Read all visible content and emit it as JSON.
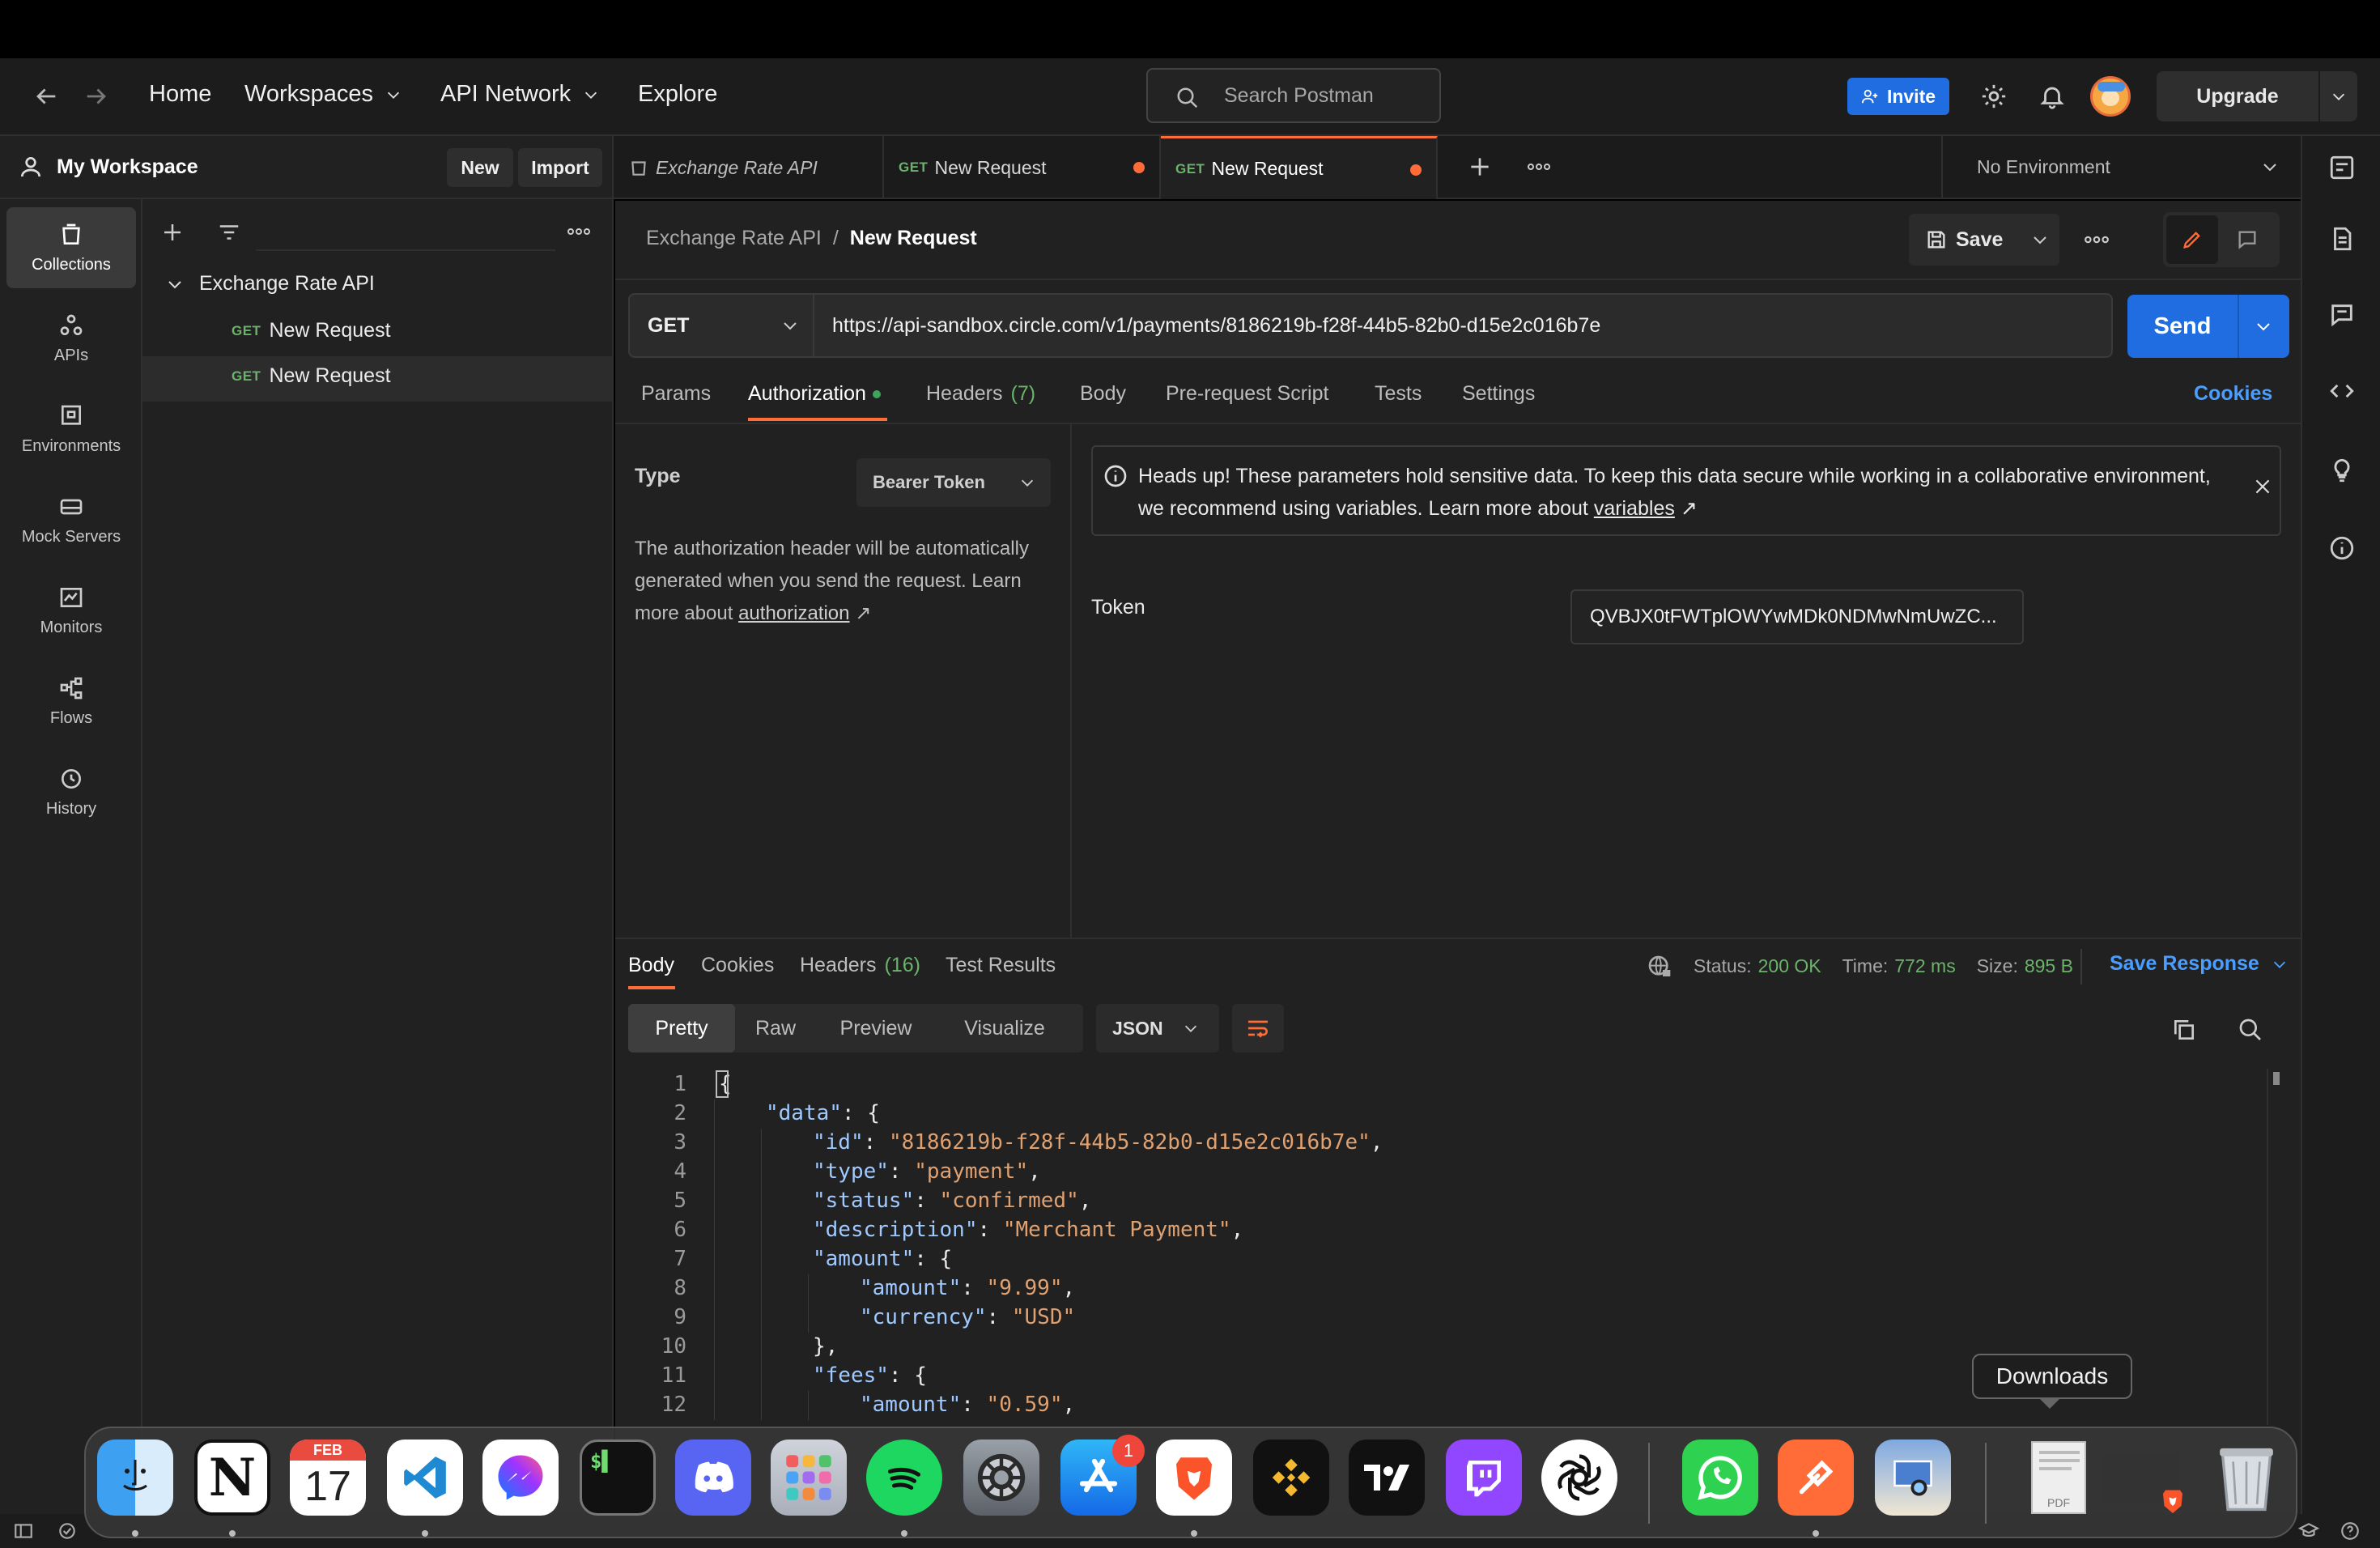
{
  "topbar": {
    "nav": [
      "Home",
      "Workspaces",
      "API Network",
      "Explore"
    ],
    "search_placeholder": "Search Postman",
    "invite_label": "Invite",
    "upgrade_label": "Upgrade"
  },
  "workspace": {
    "name": "My Workspace",
    "new_label": "New",
    "import_label": "Import"
  },
  "rail": [
    "Collections",
    "APIs",
    "Environments",
    "Mock Servers",
    "Monitors",
    "Flows",
    "History"
  ],
  "sidebar": {
    "collection": "Exchange Rate API",
    "requests": [
      {
        "method": "GET",
        "name": "New Request"
      },
      {
        "method": "GET",
        "name": "New Request"
      }
    ]
  },
  "tabs": [
    {
      "method": "",
      "label": "Exchange Rate API"
    },
    {
      "method": "GET",
      "label": "New Request"
    },
    {
      "method": "GET",
      "label": "New Request"
    }
  ],
  "environment": "No Environment",
  "breadcrumb": {
    "parent": "Exchange Rate API",
    "sep": "/",
    "current": "New Request"
  },
  "save_label": "Save",
  "request": {
    "method": "GET",
    "url": "https://api-sandbox.circle.com/v1/payments/8186219b-f28f-44b5-82b0-d15e2c016b7e",
    "send_label": "Send",
    "tabs": [
      "Params",
      "Authorization",
      "Headers",
      "Body",
      "Pre-request Script",
      "Tests",
      "Settings"
    ],
    "headers_count": "(7)",
    "cookies_label": "Cookies"
  },
  "auth": {
    "type_label": "Type",
    "type_value": "Bearer Token",
    "description": "The authorization header will be automatically generated when you send the request. Learn more about",
    "description_link": "authorization",
    "notice_line1": "Heads up! These parameters hold sensitive data. To keep this data secure while working in a collaborative environment,",
    "notice_line2": "we recommend using variables. Learn more about",
    "notice_link": "variables",
    "token_label": "Token",
    "token_value": "QVBJX0tFWTplOWYwMDk0NDMwNmUwZC..."
  },
  "response": {
    "tabs": [
      "Body",
      "Cookies",
      "Headers",
      "Test Results"
    ],
    "headers_count": "(16)",
    "status_label": "Status:",
    "status_value": "200 OK",
    "time_label": "Time:",
    "time_value": "772 ms",
    "size_label": "Size:",
    "size_value": "895 B",
    "save_response_label": "Save Response",
    "view_tabs": [
      "Pretty",
      "Raw",
      "Preview",
      "Visualize"
    ],
    "format": "JSON",
    "code_lines": [
      {
        "n": "1",
        "indent": 0,
        "key": "",
        "val": "",
        "tail": "{"
      },
      {
        "n": "2",
        "indent": 1,
        "key": "\"data\"",
        "val": "",
        "tail": ": {"
      },
      {
        "n": "3",
        "indent": 2,
        "key": "\"id\"",
        "val": "\"8186219b-f28f-44b5-82b0-d15e2c016b7e\"",
        "tail": ","
      },
      {
        "n": "4",
        "indent": 2,
        "key": "\"type\"",
        "val": "\"payment\"",
        "tail": ","
      },
      {
        "n": "5",
        "indent": 2,
        "key": "\"status\"",
        "val": "\"confirmed\"",
        "tail": ","
      },
      {
        "n": "6",
        "indent": 2,
        "key": "\"description\"",
        "val": "\"Merchant Payment\"",
        "tail": ","
      },
      {
        "n": "7",
        "indent": 2,
        "key": "\"amount\"",
        "val": "",
        "tail": ": {"
      },
      {
        "n": "8",
        "indent": 3,
        "key": "\"amount\"",
        "val": "\"9.99\"",
        "tail": ","
      },
      {
        "n": "9",
        "indent": 3,
        "key": "\"currency\"",
        "val": "\"USD\"",
        "tail": ""
      },
      {
        "n": "10",
        "indent": 2,
        "key": "",
        "val": "",
        "tail": "},"
      },
      {
        "n": "11",
        "indent": 2,
        "key": "\"fees\"",
        "val": "",
        "tail": ": {"
      },
      {
        "n": "12",
        "indent": 3,
        "key": "\"amount\"",
        "val": "\"0.59\"",
        "tail": ","
      }
    ]
  },
  "dock": {
    "tooltip": "Downloads",
    "calendar_month": "FEB",
    "calendar_day": "17",
    "appstore_badge": "1",
    "pdf_label": "PDF"
  }
}
